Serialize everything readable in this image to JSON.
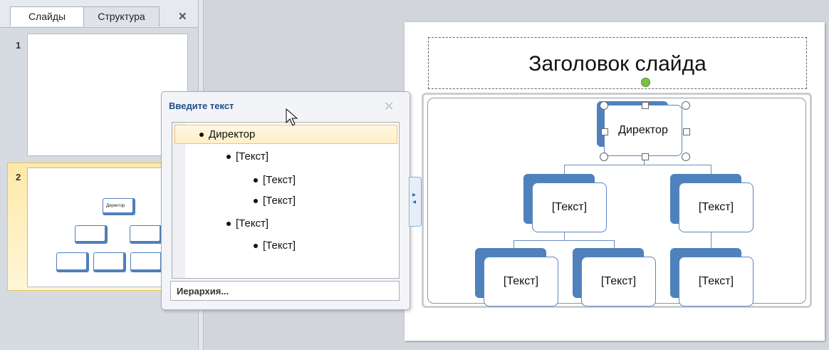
{
  "left_pane": {
    "tabs": [
      {
        "label": "Слайды"
      },
      {
        "label": "Структура"
      }
    ],
    "close_glyph": "✕",
    "slides": [
      {
        "number": "1"
      },
      {
        "number": "2",
        "thumbnail_label": "Директор"
      }
    ]
  },
  "slide": {
    "title": "Заголовок слайда"
  },
  "smartart": {
    "nodes": [
      {
        "label": "Директор"
      },
      {
        "label": "[Текст]"
      },
      {
        "label": "[Текст]"
      },
      {
        "label": "[Текст]"
      },
      {
        "label": "[Текст]"
      },
      {
        "label": "[Текст]"
      }
    ]
  },
  "text_pane": {
    "title": "Введите текст",
    "close_glyph": "⤫",
    "lines": [
      {
        "text": "Директор",
        "level": 1
      },
      {
        "text": "[Текст]",
        "level": 2
      },
      {
        "text": "[Текст]",
        "level": 3
      },
      {
        "text": "[Текст]",
        "level": 3
      },
      {
        "text": "[Текст]",
        "level": 2
      },
      {
        "text": "[Текст]",
        "level": 3
      }
    ],
    "layout_name": "Иерархия..."
  },
  "icons": {
    "pane_toggle": "chevron-right-left-icon",
    "cursor": "mouse-pointer-icon"
  },
  "colors": {
    "smartart_accent": "#4f81bd",
    "selection_highlight": "#ffefc6",
    "rotate_handle": "#7ac143"
  }
}
